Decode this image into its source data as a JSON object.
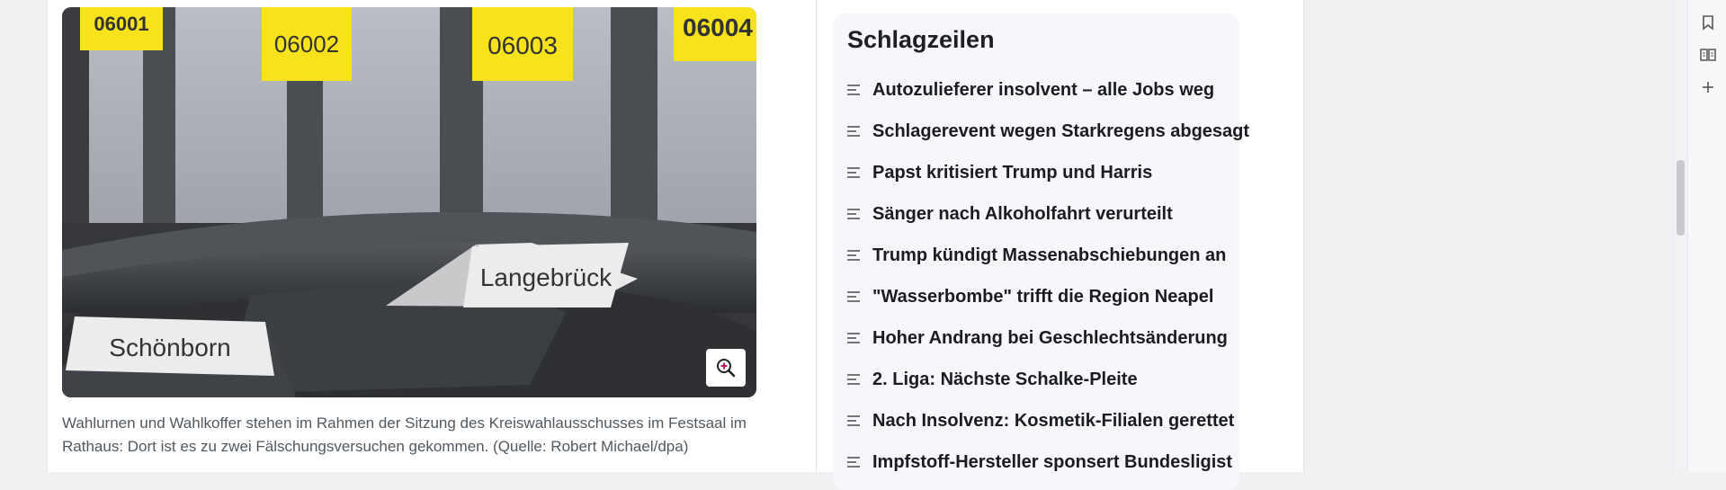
{
  "image": {
    "alt": "Wahlurnen und Wahlkoffer",
    "tags": [
      "06001",
      "06002",
      "06003",
      "06004"
    ],
    "signs": [
      "Langebrück",
      "Schönborn"
    ]
  },
  "caption": "Wahlurnen und Wahlkoffer stehen im Rahmen der Sitzung des Kreiswahlausschusses im Festsaal im Rathaus: Dort ist es zu zwei Fälschungsversuchen gekommen. (Quelle: Robert Michael/dpa)",
  "sidebar": {
    "title": "Schlagzeilen",
    "items": [
      {
        "label": "Autozulieferer insolvent – alle Jobs weg"
      },
      {
        "label": "Schlagerevent wegen Starkregens abgesagt"
      },
      {
        "label": "Papst kritisiert Trump und Harris"
      },
      {
        "label": "Sänger nach Alkoholfahrt verurteilt"
      },
      {
        "label": "Trump kündigt Massenabschiebungen an"
      },
      {
        "label": "\"Wasserbombe\" trifft die Region Neapel"
      },
      {
        "label": "Hoher Andrang bei Geschlechtsänderung"
      },
      {
        "label": "2. Liga: Nächste Schalke-Pleite"
      },
      {
        "label": "Nach Insolvenz: Kosmetik-Filialen gerettet"
      },
      {
        "label": "Impfstoff-Hersteller sponsert Bundesligist"
      }
    ]
  },
  "right_toolbar": {
    "icons": [
      "bookmark-icon",
      "reader-icon",
      "add-icon"
    ]
  },
  "colors": {
    "accent": "#c2185b",
    "tag_yellow": "#f7e21b",
    "sidebar_bg": "#f5f7fa"
  }
}
